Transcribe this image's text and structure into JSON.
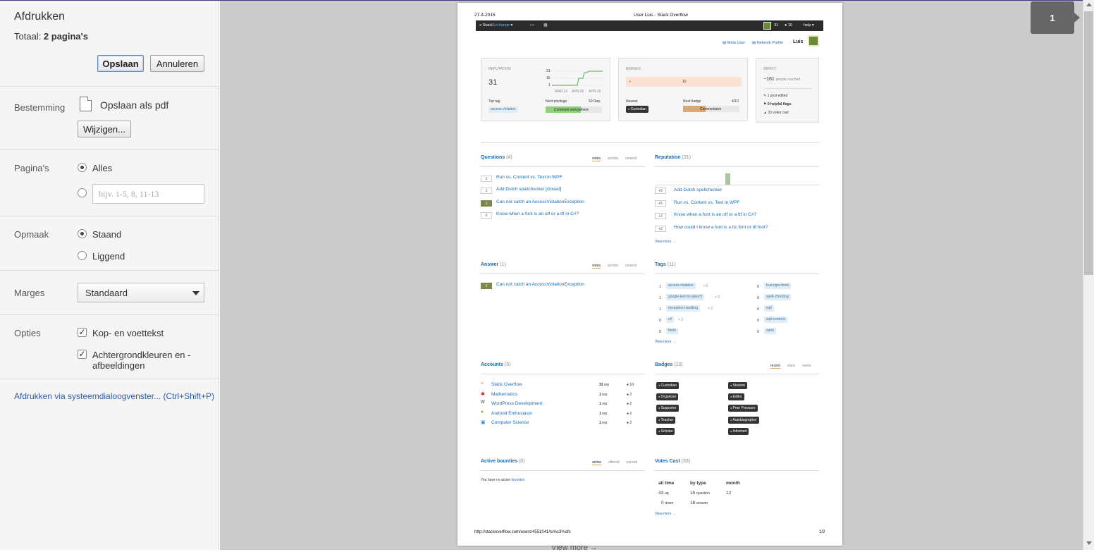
{
  "panel": {
    "title": "Afdrukken",
    "total_prefix": "Totaal: ",
    "total_value": "2 pagina's",
    "save_label": "Opslaan",
    "cancel_label": "Annuleren",
    "destination_label": "Bestemming",
    "destination_value": "Opslaan als pdf",
    "change_label": "Wijzigen...",
    "pages_label": "Pagina's",
    "pages_all": "Alles",
    "pages_placeholder": "bijv. 1-5, 8, 11-13",
    "layout_label": "Opmaak",
    "layout_portrait": "Staand",
    "layout_landscape": "Liggend",
    "margins_label": "Marges",
    "margins_value": "Standaard",
    "options_label": "Opties",
    "option_header_footer": "Kop- en voettekst",
    "option_background_1": "Achtergrondkleuren en -",
    "option_background_2": "afbeeldingen",
    "system_dialog_link": "Afdrukken via systeemdialoogvenster... (Ctrl+Shift+P)"
  },
  "preview": {
    "page_number": "1",
    "below_page_text": "View more →"
  },
  "page": {
    "header_date": "27-4-2015",
    "header_title": "User Luis - Stack Overflow",
    "footer_url": "http://stackoverflow.com/users/4551041/lu%c3%afs",
    "footer_page": "1/2",
    "topbar": {
      "brand_stack": "Stack",
      "brand_exchange": "Exchange",
      "rep": "31",
      "badges": "● 10",
      "help": "help ▾"
    },
    "user_links": {
      "meta_user": "Meta User",
      "network_profile": "Network Profile",
      "username": "Luis"
    },
    "reputation_card": {
      "heading": "REPUTATION",
      "value": "31",
      "axis_31": "31",
      "axis_16": "16",
      "axis_1": "1",
      "dates": [
        "MAR 13",
        "APR 06",
        "APR 28"
      ],
      "top_tag_label": "Top tag",
      "top_tag": "access-violation",
      "next_priv_label": "Next privilege",
      "next_priv_rep": "50 Rep.",
      "next_priv_name": "Comment everywhere"
    },
    "badges_card": {
      "heading": "BADGES",
      "count": "10",
      "newest_label": "Newest",
      "newest_badge": "Custodian",
      "next_badge_label": "Next badge",
      "next_badge_progress": "4/10",
      "next_badge_name": "Commentator"
    },
    "impact_card": {
      "heading": "IMPACT",
      "reach_value": "~161",
      "reach_text": "people reached",
      "posts_edited": "1 post edited",
      "helpful_flags": "0 helpful flags",
      "votes_cast": "33 votes cast"
    },
    "questions": {
      "title": "Questions",
      "count": "(4)",
      "tabs": [
        "votes",
        "activity",
        "newest"
      ],
      "items": [
        {
          "votes": "1",
          "title": "Run vs. Content vs. Text in WPF",
          "accepted": false
        },
        {
          "votes": "1",
          "title": "Add Dutch spellchecker [closed]",
          "accepted": false
        },
        {
          "votes": "1",
          "title": "Can not catch an AccessViolationException",
          "accepted": true
        },
        {
          "votes": "0",
          "title": "Know when a font is an otf or a ttf in C#?",
          "accepted": false
        }
      ]
    },
    "reputation": {
      "title": "Reputation",
      "count": "(31)",
      "items": [
        {
          "rep": "+5",
          "title": "Add Dutch spellchecker"
        },
        {
          "rep": "+5",
          "title": "Run vs. Content vs. Text in WPF"
        },
        {
          "rep": "+3",
          "title": "Know when a font is an otf or a ttf in C#?"
        },
        {
          "rep": "+2",
          "title": "How could I know a font is a ttc font or ttf font?"
        }
      ],
      "view_more": "View more →"
    },
    "answers": {
      "title": "Answer",
      "count": "(1)",
      "tabs": [
        "votes",
        "activity",
        "newest"
      ],
      "items": [
        {
          "votes": "1",
          "title": "Can not catch an AccessViolationException",
          "accepted": true
        }
      ]
    },
    "tags": {
      "title": "Tags",
      "count": "(11)",
      "left": [
        {
          "score": "1",
          "name": "access-violation",
          "mult": "× 2"
        },
        {
          "score": "1",
          "name": "google-text-to-speech",
          "mult": "× 2"
        },
        {
          "score": "1",
          "name": "exception-handling",
          "mult": "× 2"
        },
        {
          "score": "0",
          "name": "c#",
          "mult": "× 2"
        },
        {
          "score": "0",
          "name": "fonts",
          "mult": ""
        }
      ],
      "right": [
        {
          "score": "0",
          "name": "true-type-fonts"
        },
        {
          "score": "0",
          "name": "spell-checking"
        },
        {
          "score": "0",
          "name": "wpf"
        },
        {
          "score": "0",
          "name": "wpf-controls"
        },
        {
          "score": "0",
          "name": "xaml"
        }
      ],
      "view_more": "View more →"
    },
    "accounts": {
      "title": "Accounts",
      "count": "(5)",
      "items": [
        {
          "name": "Stack Overflow",
          "rep": "31",
          "rep_label": "rep",
          "badges": "● 10"
        },
        {
          "name": "Mathematics",
          "rep": "1",
          "rep_label": "rep",
          "badges": "● 2"
        },
        {
          "name": "WordPress Development",
          "rep": "1",
          "rep_label": "rep",
          "badges": "● 2"
        },
        {
          "name": "Android Enthusiasts",
          "rep": "1",
          "rep_label": "rep",
          "badges": "● 2"
        },
        {
          "name": "Computer Science",
          "rep": "1",
          "rep_label": "rep",
          "badges": "● 2"
        }
      ]
    },
    "badges": {
      "title": "Badges",
      "count": "(10)",
      "tabs": [
        "recent",
        "class",
        "name"
      ],
      "left": [
        "Custodian",
        "Organizer",
        "Supporter",
        "Teacher",
        "Scholar"
      ],
      "right": [
        "Student",
        "Editor",
        "Peer Pressure",
        "Autobiographer",
        "Informed"
      ]
    },
    "bounties": {
      "title": "Active bounties",
      "count": "(0)",
      "tabs": [
        "active",
        "offered",
        "earned"
      ],
      "empty_text": "You have no active ",
      "empty_link": "bounties"
    },
    "votes": {
      "title": "Votes Cast",
      "count": "(33)",
      "col1": "all time",
      "col2": "by type",
      "col3": "month",
      "up_count": "33",
      "up_label": "up",
      "down_count": "0",
      "down_label": "down",
      "question_count": "15",
      "question_label": "question",
      "answer_count": "18",
      "answer_label": "answer",
      "month_count": "12",
      "view_more": "View more →"
    }
  }
}
